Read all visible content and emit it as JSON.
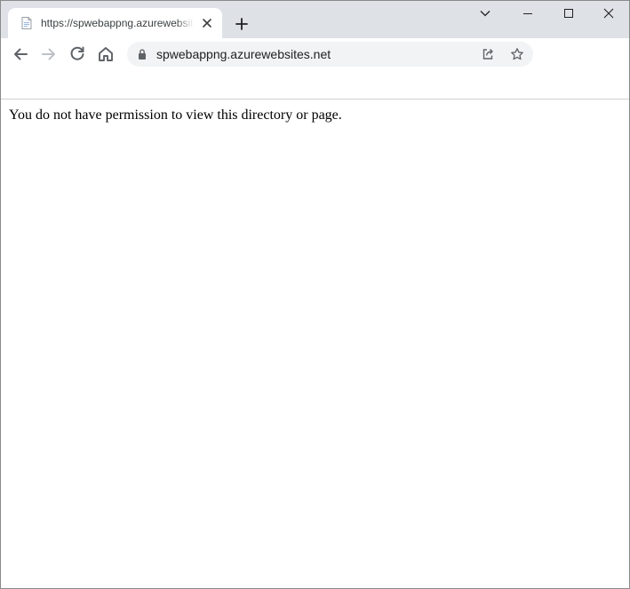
{
  "tab": {
    "title": "https://spwebappng.azurewebsites.net",
    "favicon": "page-icon"
  },
  "omnibox": {
    "url": "spwebappng.azurewebsites.net",
    "security_icon": "lock-icon"
  },
  "page": {
    "message": "You do not have permission to view this directory or page."
  },
  "colors": {
    "tabstrip_bg": "#dee1e6",
    "omnibox_bg": "#f1f3f4",
    "icon_gray": "#5f6368"
  }
}
